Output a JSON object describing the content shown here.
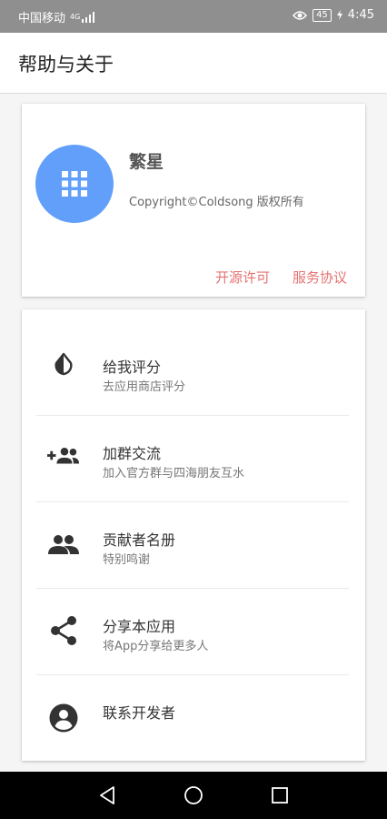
{
  "status_bar": {
    "carrier": "中国移动",
    "network": "4G",
    "battery": "45",
    "time": "4:45"
  },
  "header": {
    "title": "帮助与关于"
  },
  "about": {
    "app_name": "繁星",
    "copyright": "Copyright©Coldsong 版权所有",
    "open_source_label": "开源许可",
    "terms_label": "服务协议",
    "logo_icon": "apps-grid-icon"
  },
  "menu": {
    "items": [
      {
        "title": "给我评分",
        "subtitle": "去应用商店评分",
        "icon": "invert-colors-icon"
      },
      {
        "title": "加群交流",
        "subtitle": "加入官方群与四海朋友互水",
        "icon": "group-add-icon"
      },
      {
        "title": "贡献者名册",
        "subtitle": "特别鸣谢",
        "icon": "people-icon"
      },
      {
        "title": "分享本应用",
        "subtitle": "将App分享给更多人",
        "icon": "share-icon"
      },
      {
        "title": "联系开发者",
        "subtitle": "",
        "icon": "account-circle-icon"
      }
    ]
  },
  "colors": {
    "status_bar": "#8f8f8f",
    "logo_bg": "#619ffa",
    "link": "#e57373",
    "nav_bar": "#000000"
  }
}
